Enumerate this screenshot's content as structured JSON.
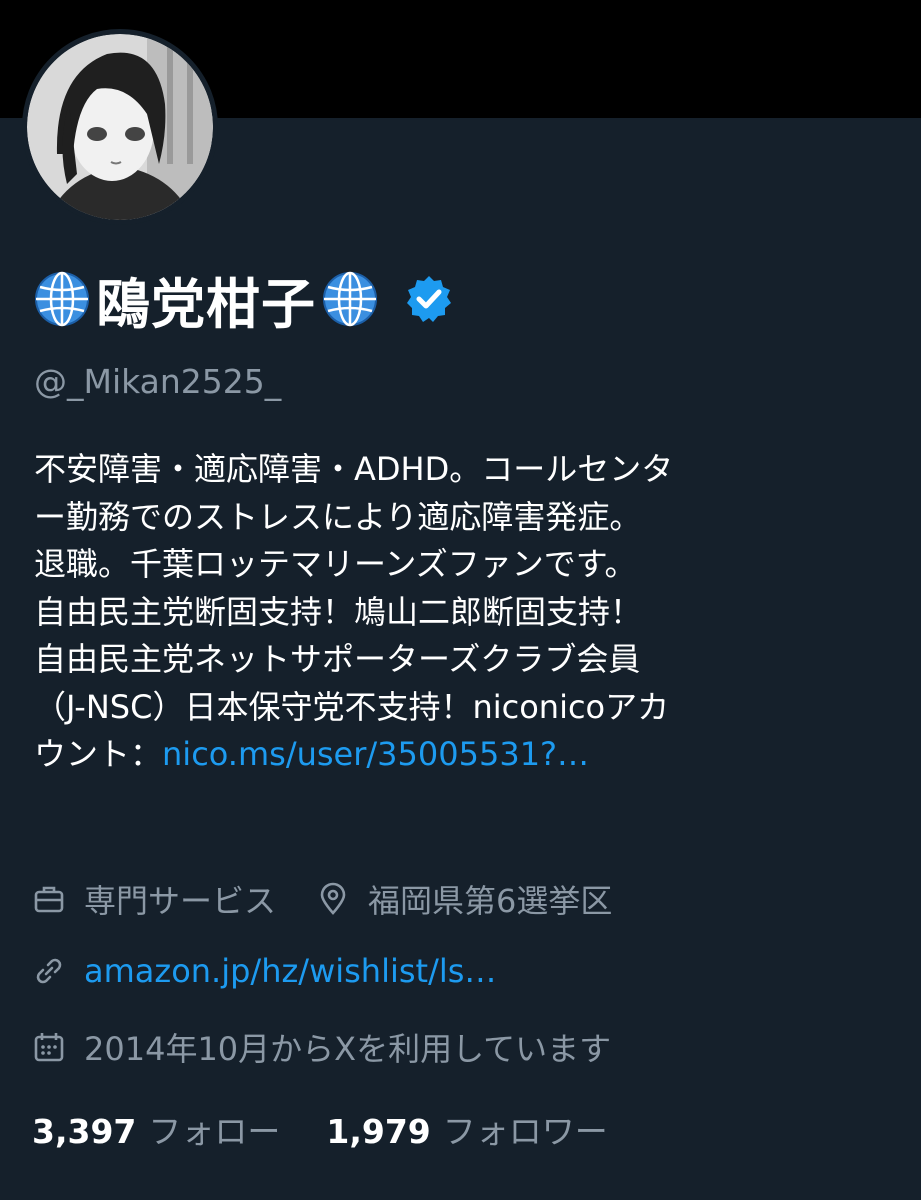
{
  "profile": {
    "display_name": "鴎党柑子",
    "handle": "@_Mikan2525_",
    "bio_lines": [
      "不安障害・適応障害・ADHD。コールセンタ",
      "ー勤務でのストレスにより適応障害発症。",
      "退職。千葉ロッテマリーンズファンです。",
      "自由民主党断固支持！鳩山二郎断固支持！",
      "自由民主党ネットサポーターズクラブ会員",
      "（J-NSC）日本保守党不支持！niconicoアカ",
      "ウント："
    ],
    "bio_link": "nico.ms/user/35005531?…",
    "category": "専門サービス",
    "location": "福岡県第6選挙区",
    "website": "amazon.jp/hz/wishlist/ls…",
    "joined": "2014年10月からXを利用しています",
    "following_count": "3,397",
    "following_label": "フォロー",
    "followers_count": "1,979",
    "followers_label": "フォロワー"
  },
  "icons": {
    "name_left": "globe-icon",
    "name_right": "globe-icon",
    "verified": "verified-badge-icon",
    "category": "briefcase-icon",
    "location": "location-pin-icon",
    "website": "link-icon",
    "joined": "calendar-icon"
  },
  "colors": {
    "background": "#15202b",
    "top_band": "#000000",
    "accent": "#1d9bf0",
    "secondary_text": "#8b98a5",
    "primary_text": "#ffffff"
  }
}
